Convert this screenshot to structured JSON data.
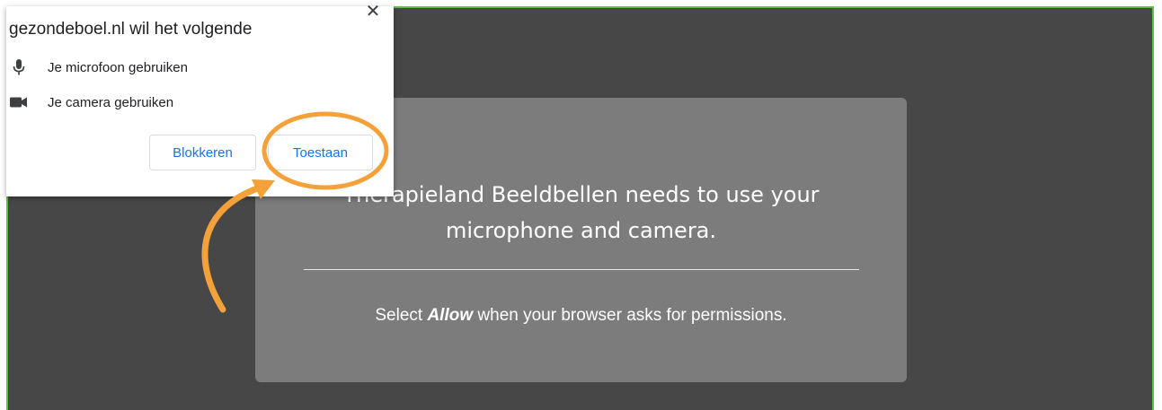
{
  "dialog": {
    "title": "gezondeboel.nl wil het volgende",
    "close_symbol": "✕",
    "permissions": [
      {
        "icon": "microphone-icon",
        "label": "Je microfoon gebruiken"
      },
      {
        "icon": "camera-icon",
        "label": "Je camera gebruiken"
      }
    ],
    "block_label": "Blokkeren",
    "allow_label": "Toestaan"
  },
  "info": {
    "heading_line1": "Therapieland Beeldbellen needs to use your",
    "heading_line2": "microphone and camera.",
    "sub_before": "Select ",
    "sub_emphasis": "Allow",
    "sub_after": " when your browser asks for permissions."
  },
  "colors": {
    "background": "#474747",
    "card": "#7c7c7c",
    "frame_border": "#5cbf46",
    "highlight": "#f4a13a",
    "button_text": "#1a73e8"
  },
  "annotation": {
    "highlight_target": "Toestaan",
    "arrow": "curved-arrow-pointing-up-right"
  }
}
